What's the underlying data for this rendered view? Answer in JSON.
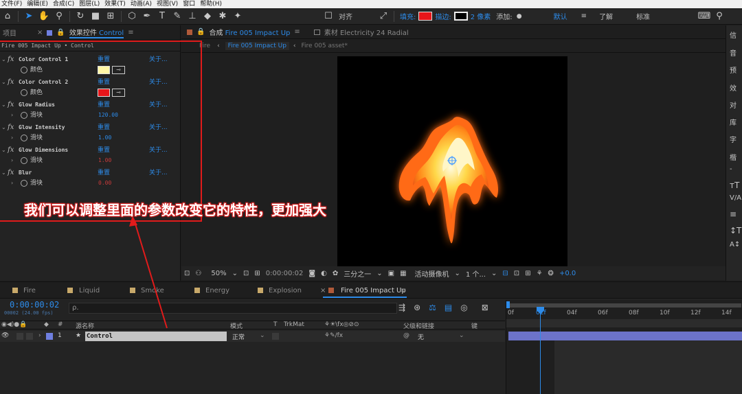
{
  "menu": [
    "文件(F)",
    "编辑(E)",
    "合成(C)",
    "图层(L)",
    "效果(T)",
    "动画(A)",
    "视图(V)",
    "窗口",
    "帮助(H)"
  ],
  "toolbar": {
    "snap_label": "对齐",
    "fill_label": "填充:",
    "stroke_label": "描边:",
    "stroke_width": "2 像素",
    "add_label": "添加:",
    "workspaces": [
      "默认",
      "了解",
      "标准"
    ],
    "fill_color": "#e8161a"
  },
  "left_panel": {
    "tab_project": "项目",
    "tab_effects": "效果控件",
    "tab_effects_target": "Control",
    "header": "Fire 005 Impact Up • Control",
    "reset_label": "重置",
    "about_label": "关于...",
    "effects": [
      {
        "name": "Color Control 1",
        "prop": "颜色",
        "color": "#fff7a6"
      },
      {
        "name": "Color Control 2",
        "prop": "颜色",
        "color": "#e8161a"
      },
      {
        "name": "Glow Radius",
        "prop": "滑块",
        "value": "120.00"
      },
      {
        "name": "Glow Intensity",
        "prop": "滑块",
        "value": "1.00"
      },
      {
        "name": "Glow Dimensions",
        "prop": "滑块",
        "value": "1.00"
      },
      {
        "name": "Blur",
        "prop": "滑块",
        "value": "0.00"
      }
    ]
  },
  "comp_panel": {
    "tab_comp_prefix": "合成",
    "tab_comp_name": "Fire 005 Impact Up",
    "tab_footage_prefix": "素材",
    "tab_footage_name": "Electricity 24 Radial",
    "breadcrumb": [
      "Fire",
      "Fire 005 Impact Up",
      "Fire 005 asset*"
    ],
    "zoom": "50%",
    "timecode": "0:00:00:02",
    "resolution": "三分之一",
    "camera": "活动摄像机",
    "views": "1 个...",
    "exposure": "+0.0"
  },
  "right_panel": {
    "items": [
      "信",
      "音",
      "预",
      "效",
      "对",
      "库",
      "字",
      "楷",
      "-"
    ]
  },
  "timeline": {
    "tabs": [
      {
        "label": "Fire",
        "color": "#c8a96a"
      },
      {
        "label": "Liquid",
        "color": "#c8a96a"
      },
      {
        "label": "Smoke",
        "color": "#c8a96a"
      },
      {
        "label": "Energy",
        "color": "#c8a96a"
      },
      {
        "label": "Explosion",
        "color": "#c8a96a"
      },
      {
        "label": "Fire 005 Impact Up",
        "color": "#b05a3a"
      }
    ],
    "timecode": "0:00:00:02",
    "fps": "00002 (24.00 fps)",
    "search_placeholder": "ρ.",
    "col_source": "源名称",
    "col_mode": "模式",
    "col_t": "T",
    "col_trkmat": "TrkMat",
    "col_parent": "父级和链接",
    "col_key": "键",
    "layer": {
      "index": "1",
      "name": "Control",
      "mode": "正常",
      "parent": "无",
      "color": "#6f7fe0"
    },
    "ruler": [
      "0f",
      "02f",
      "04f",
      "06f",
      "08f",
      "10f",
      "12f",
      "14f"
    ]
  },
  "annotation": "我们可以调整里面的参数改变它的特性，更加强大"
}
